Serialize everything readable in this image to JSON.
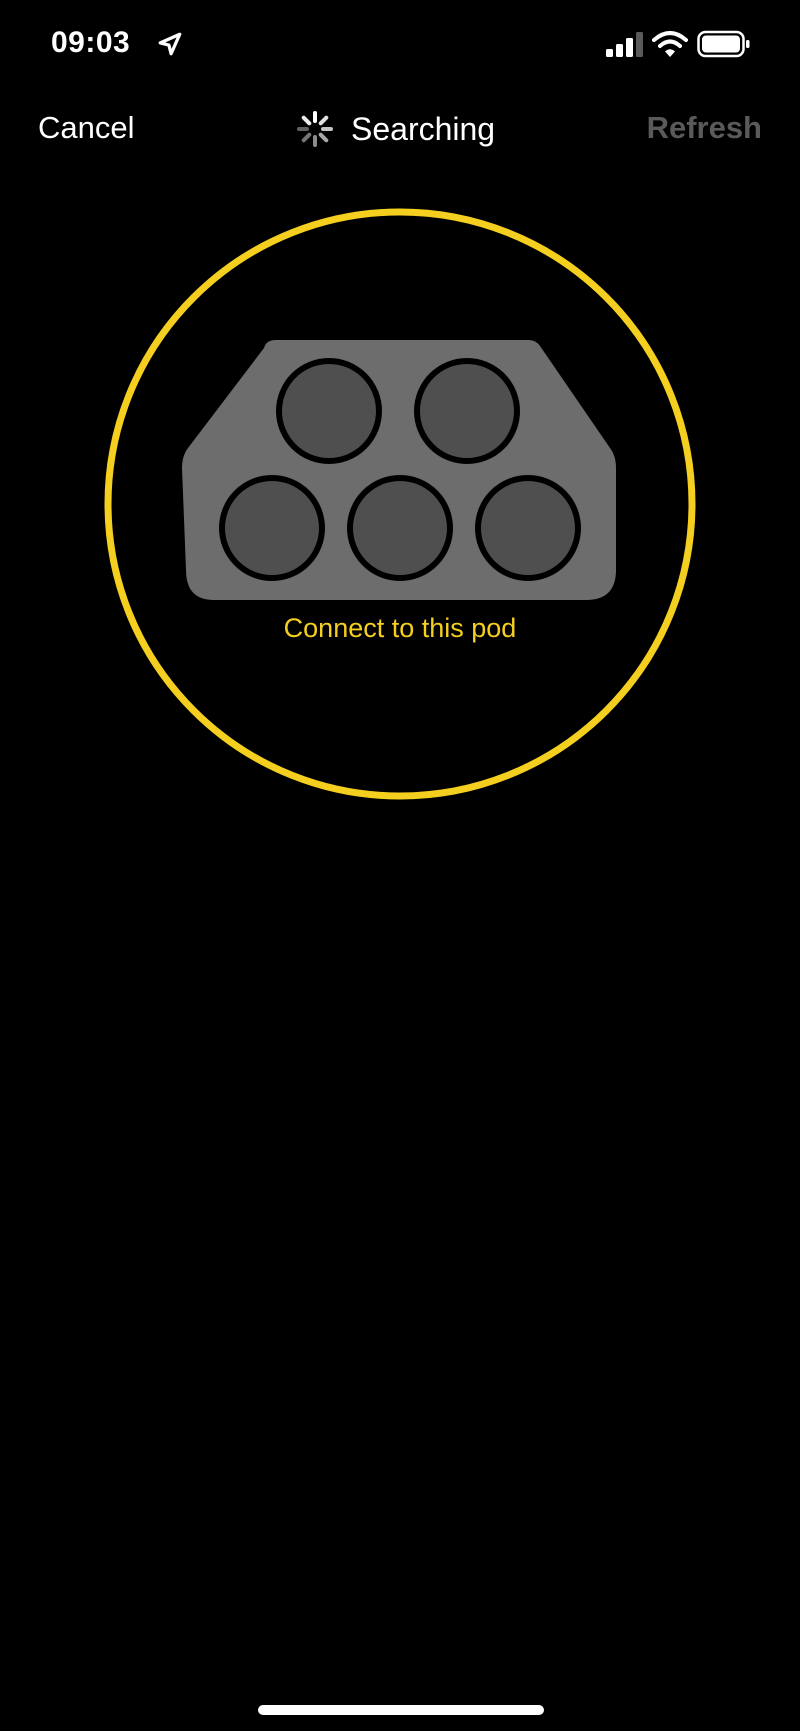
{
  "status_bar": {
    "time": "09:03",
    "icons": [
      "location-arrow-icon",
      "cellular-signal-icon",
      "wifi-icon",
      "battery-icon"
    ]
  },
  "nav": {
    "cancel_label": "Cancel",
    "title": "Searching",
    "refresh_label": "Refresh",
    "spinner_icon": "activity-spinner-icon"
  },
  "pod": {
    "label": "Connect to this pod",
    "icon": "pod-connector-icon",
    "socket_count": 5
  },
  "colors": {
    "background": "#000000",
    "accent_yellow": "#f5cf1f",
    "pod_body": "#6d6d6d",
    "socket_fill": "#4f4f50",
    "refresh_disabled": "#5a5a5a"
  }
}
